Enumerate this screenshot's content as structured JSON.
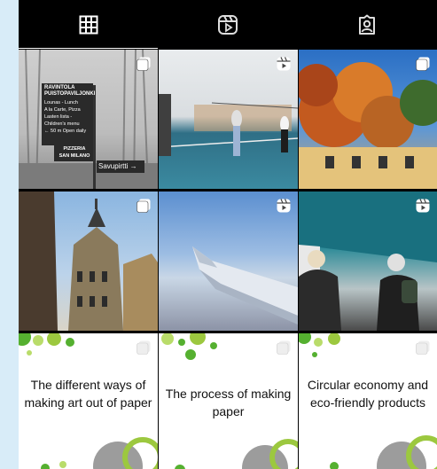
{
  "tabs": [
    {
      "name": "posts-grid",
      "icon": "grid-icon",
      "active": true
    },
    {
      "name": "reels",
      "icon": "reels-icon",
      "active": false
    },
    {
      "name": "tagged",
      "icon": "tagged-icon",
      "active": false
    }
  ],
  "posts": {
    "row1": [
      {
        "badge": "carousel-icon",
        "sign": {
          "title": "RAVINTOLA\nPUISTOPAVILJONKI",
          "menu": "Lounas - Lunch\nA la Carte, Pizza\nLasten lista -\nChildren's menu\n← 50 m Open daily",
          "pizzeria": "PIZZERIA\nSAN MILANO",
          "street": "Savupirtti →"
        }
      },
      {
        "badge": "reel-icon"
      },
      {
        "badge": "carousel-icon"
      }
    ],
    "row2": [
      {
        "badge": "carousel-icon"
      },
      {
        "badge": "reel-icon"
      },
      {
        "badge": "reel-icon"
      }
    ],
    "row3": [
      {
        "caption": "The different ways of making art out of paper"
      },
      {
        "caption": "The process of making paper"
      },
      {
        "caption": "Circular economy and eco-friendly products"
      }
    ]
  },
  "colors": {
    "accent_green": "#55b030",
    "light_green": "#b9dc6a",
    "grey_blob": "#9c9c9c"
  }
}
